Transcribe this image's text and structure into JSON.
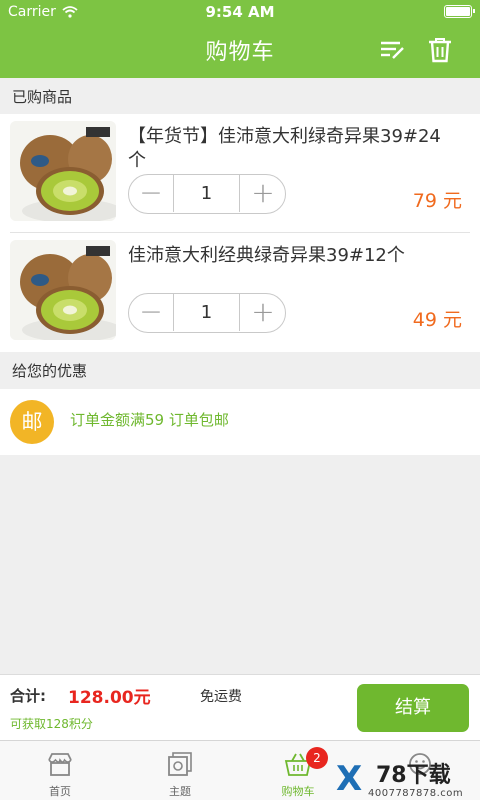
{
  "status_bar": {
    "carrier": "Carrier",
    "time": "9:54 AM"
  },
  "nav": {
    "title": "购物车"
  },
  "sections": {
    "purchased": "已购商品",
    "offers": "给您的优惠"
  },
  "items": [
    {
      "title": "【年货节】佳沛意大利绿奇异果39#24个",
      "quantity": "1",
      "price": "79 元"
    },
    {
      "title": "佳沛意大利经典绿奇异果39#12个",
      "quantity": "1",
      "price": "49 元"
    }
  ],
  "promo": {
    "badge": "邮",
    "text": "订单金额满59 订单包邮"
  },
  "checkout": {
    "total_label": "合计:",
    "total_value": "128.00元",
    "shipping": "免运费",
    "points": "可获取128积分",
    "settle_label": "结算"
  },
  "tabs": [
    {
      "label": "首页"
    },
    {
      "label": "主题"
    },
    {
      "label": "购物车",
      "badge": "2"
    },
    {
      "label": ""
    }
  ],
  "watermark": {
    "brand": "78下载",
    "url": "4007787878.com"
  },
  "colors": {
    "brand_green": "#7dc443",
    "price_orange": "#f06a1e",
    "total_red": "#e8261f",
    "badge_yellow": "#f2b526"
  }
}
